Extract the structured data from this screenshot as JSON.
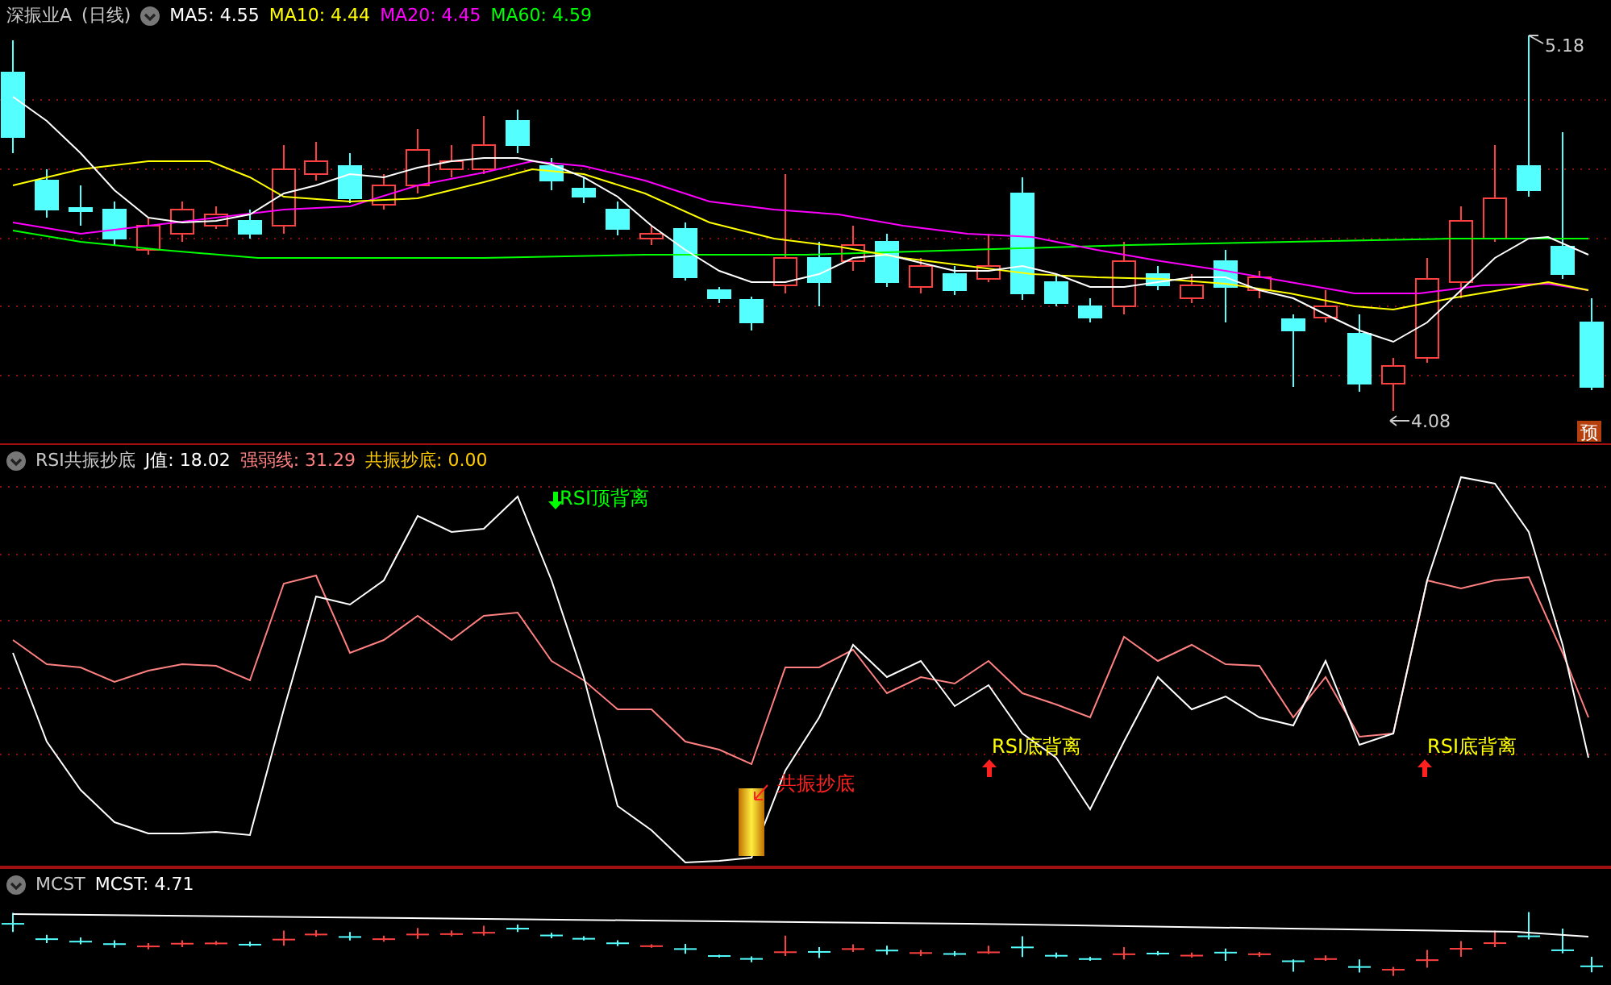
{
  "main_chart": {
    "title": "深振业A",
    "period": "(日线)",
    "indicators": [
      {
        "text": "MA5: 4.55",
        "color": "#ffffff"
      },
      {
        "text": "MA10: 4.44",
        "color": "#ffff00"
      },
      {
        "text": "MA20: 4.45",
        "color": "#ff00ff"
      },
      {
        "text": "MA60: 4.59",
        "color": "#00ff00"
      }
    ],
    "high_label": "5.18",
    "low_label": "4.08",
    "badge": "预"
  },
  "rsi_panel": {
    "title": "RSI共振抄底",
    "readings": [
      {
        "text": "J值: 18.02",
        "color": "#ffffff"
      },
      {
        "text": "强弱线: 31.29",
        "color": "#ff8080"
      },
      {
        "text": "共振抄底: 0.00",
        "color": "#ffcc00"
      }
    ],
    "signals": [
      {
        "kind": "top",
        "text": "RSI顶背离"
      },
      {
        "kind": "buy",
        "text": "共振抄底"
      },
      {
        "kind": "bottom",
        "text": "RSI底背离"
      },
      {
        "kind": "bottom",
        "text": "RSI底背离"
      }
    ]
  },
  "mcst_panel": {
    "title": "MCST",
    "readings": [
      {
        "text": "MCST: 4.71",
        "color": "#ffffff"
      }
    ]
  }
}
